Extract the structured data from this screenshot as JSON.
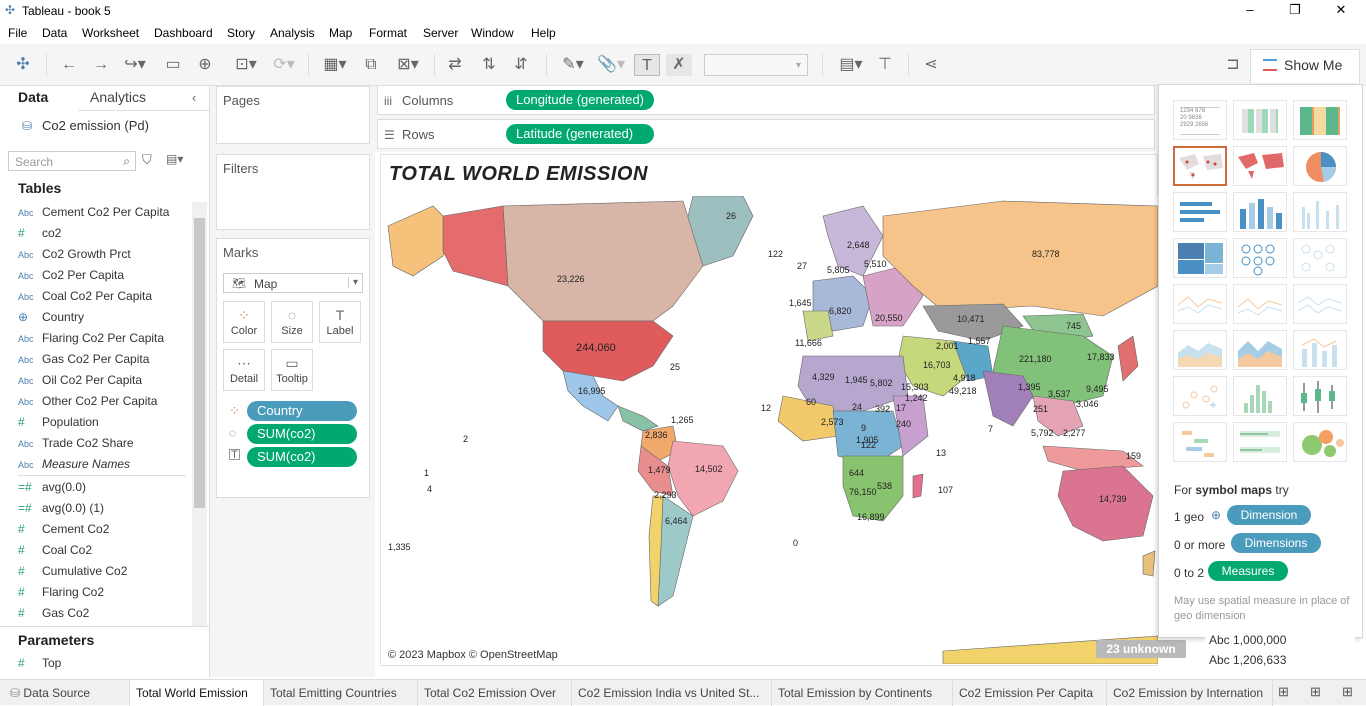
{
  "window": {
    "title": "Tableau - book 5"
  },
  "menu": [
    "File",
    "Data",
    "Worksheet",
    "Dashboard",
    "Story",
    "Analysis",
    "Map",
    "Format",
    "Server",
    "Window",
    "Help"
  ],
  "toolbar": {
    "show_me_label": "Show Me"
  },
  "left": {
    "tabs": [
      "Data",
      "Analytics"
    ],
    "datasource": "Co2 emission (Pd)",
    "search_placeholder": "Search",
    "tables_heading": "Tables",
    "fields": [
      {
        "type": "Abc",
        "name": "Cement Co2 Per Capita"
      },
      {
        "type": "#",
        "name": "co2"
      },
      {
        "type": "Abc",
        "name": "Co2 Growth Prct"
      },
      {
        "type": "Abc",
        "name": "Co2 Per Capita"
      },
      {
        "type": "Abc",
        "name": "Coal Co2 Per Capita"
      },
      {
        "type": "globe",
        "name": "Country"
      },
      {
        "type": "Abc",
        "name": "Flaring Co2 Per Capita"
      },
      {
        "type": "Abc",
        "name": "Gas Co2 Per Capita"
      },
      {
        "type": "Abc",
        "name": "Oil Co2 Per Capita"
      },
      {
        "type": "Abc",
        "name": "Other Co2 Per Capita"
      },
      {
        "type": "#",
        "name": "Population"
      },
      {
        "type": "Abc",
        "name": "Trade Co2 Share"
      },
      {
        "type": "Abc",
        "name": "Measure Names"
      }
    ],
    "measures": [
      {
        "type": "=#",
        "name": "avg(0.0)"
      },
      {
        "type": "=#",
        "name": "avg(0.0) (1)"
      },
      {
        "type": "#",
        "name": "Cement Co2"
      },
      {
        "type": "#",
        "name": "Coal Co2"
      },
      {
        "type": "#",
        "name": "Cumulative Co2"
      },
      {
        "type": "#",
        "name": "Flaring Co2"
      },
      {
        "type": "#",
        "name": "Gas Co2"
      }
    ],
    "parameters_heading": "Parameters",
    "parameters": [
      {
        "type": "#",
        "name": "Top"
      }
    ]
  },
  "cards": {
    "pages": "Pages",
    "filters": "Filters",
    "marks": "Marks",
    "mark_type": "Map",
    "mark_buttons": [
      "Color",
      "Size",
      "Label",
      "Detail",
      "Tooltip"
    ],
    "mark_pills": [
      "Country",
      "SUM(co2)",
      "SUM(co2)"
    ]
  },
  "shelves": {
    "columns_label": "Columns",
    "rows_label": "Rows",
    "columns_pill": "Longitude (generated)",
    "rows_pill": "Latitude (generated)"
  },
  "viz": {
    "title": "TOTAL WORLD EMISSION",
    "copyright": "© 2023 Mapbox © OpenStreetMap",
    "unknown": "23 unknown",
    "labels": [
      "26",
      "23,226",
      "83,778",
      "244,060",
      "16,995",
      "14,502",
      "6,464",
      "14,739",
      "221,180",
      "49,218",
      "10,471",
      "20,550",
      "2,648",
      "5,510",
      "5,805",
      "1,645",
      "6,820",
      "4,329",
      "1,945",
      "5,802",
      "15,303",
      "16,703",
      "11,666",
      "745",
      "17,833",
      "1,242",
      "4,918",
      "392",
      "240",
      "122",
      "644",
      "76,150",
      "16,899",
      "538",
      "107",
      "1,479",
      "2,293",
      "2,836",
      "1,265",
      "25",
      "27",
      "122",
      "12",
      "7",
      "0",
      "13",
      "2",
      "4",
      "1",
      "2,001",
      "1,557",
      "3,046",
      "5,792",
      "2,277",
      "3,537",
      "9,495",
      "251",
      "159",
      "2,573",
      "1,905",
      "1,395",
      "1,335",
      "60",
      "24",
      "9",
      "17"
    ]
  },
  "showme": {
    "hint_prefix": "For",
    "hint_bold": "symbol maps",
    "hint_suffix": "try",
    "req1_count": "1 geo",
    "req1_pill": "Dimension",
    "req2_count": "0 or more",
    "req2_pill": "Dimensions",
    "req3_count": "0 to 2",
    "req3_pill": "Measures",
    "note": "May use spatial measure in place of geo dimension"
  },
  "right_bottom": [
    "Abc 1,000,000",
    "Abc 1,206,633"
  ],
  "sheets": [
    "Data Source",
    "Total World Emission",
    "Total Emitting Countries",
    "Total Co2 Emission Over",
    "Co2 Emission India vs United St...",
    "Total Emission by Continents",
    "Co2 Emission Per Capita",
    "Co2 Emission by Internation"
  ],
  "colors": {
    "dimension_pill": "#4b9bbd",
    "measure_pill": "#02a96e",
    "selected_chart": "#d06a3a"
  }
}
